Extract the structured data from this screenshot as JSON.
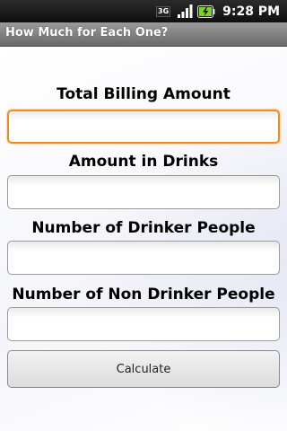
{
  "status_bar": {
    "network_type": "3G",
    "time": "9:28 PM"
  },
  "title_bar": {
    "title": "How Much for Each One?"
  },
  "form": {
    "total_billing_label": "Total Billing Amount",
    "total_billing_value": "",
    "drinks_label": "Amount in Drinks",
    "drinks_value": "",
    "drinker_people_label": "Number of Drinker People",
    "drinker_people_value": "",
    "non_drinker_people_label": "Number of Non Drinker People",
    "non_drinker_people_value": "",
    "calculate_label": "Calculate"
  },
  "colors": {
    "focus_accent": "#f08c1e",
    "battery_accent": "#7ed321"
  },
  "icons": [
    "network-3g-icon",
    "signal-strength-icon",
    "battery-charging-icon"
  ]
}
